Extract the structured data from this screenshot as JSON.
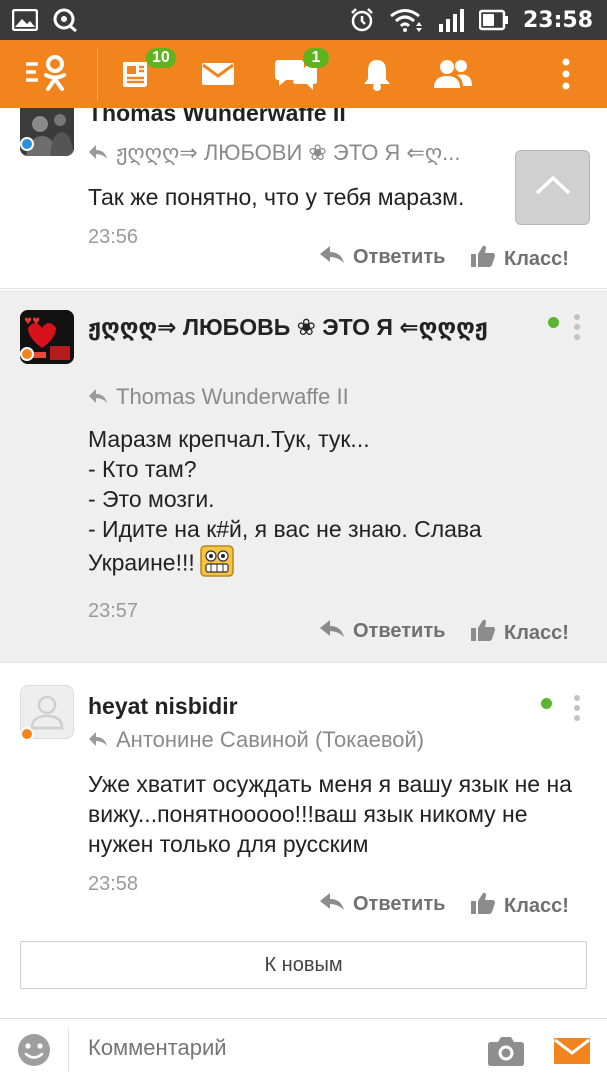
{
  "status_bar": {
    "time": "23:58",
    "icons": [
      "gallery-icon",
      "chat-bubble-icon",
      "alarm-icon",
      "wifi-icon",
      "signal-icon",
      "battery-icon"
    ]
  },
  "toolbar": {
    "icons": [
      "ok-menu-icon",
      "feed-icon",
      "mail-icon",
      "discussions-icon",
      "notifications-icon",
      "friends-icon",
      "overflow-menu-icon"
    ],
    "feed_badge": "10",
    "discussions_badge": "1",
    "accent_color": "#f2841d",
    "badge_color": "#5fb31f"
  },
  "comments": [
    {
      "author": "Thomas Wunderwaffe II",
      "reply_to": "ჟღღღ⇒ ЛЮБОВИ ❀ ЭТО Я ⇐ღ...",
      "text": "Так же понятно, что у тебя маразм.",
      "time": "23:56",
      "reply_label": "Ответить",
      "like_label": "Класс!",
      "status_color": "#2b8fd9"
    },
    {
      "author": "ჟღღღ⇒ ЛЮБОВЬ ❀ ЭТО Я ⇐ღღღჟ",
      "reply_to": "Thomas Wunderwaffe II",
      "text": "Маразм крепчал.Тук, тук...\n- Кто там?\n- Это мозги.\n- Идите на к#й, я вас не знаю. Слава Украине!!!",
      "time": "23:57",
      "reply_label": "Ответить",
      "like_label": "Класс!",
      "status_color": "#f2841d",
      "online_color": "#5cb531"
    },
    {
      "author": "heyat nisbidir",
      "reply_to": "Антонине Савиной (Токаевой)",
      "text": "Уже хватит осуждать меня я вашу язык не на вижу...понятнооооо!!!ваш язык никому не нужен только для русским",
      "time": "23:58",
      "reply_label": "Ответить",
      "like_label": "Класс!",
      "status_color": "#f2841d",
      "online_color": "#5cb531"
    }
  ],
  "new_button_label": "К новым",
  "comment_input": {
    "placeholder": "Комментарий"
  }
}
